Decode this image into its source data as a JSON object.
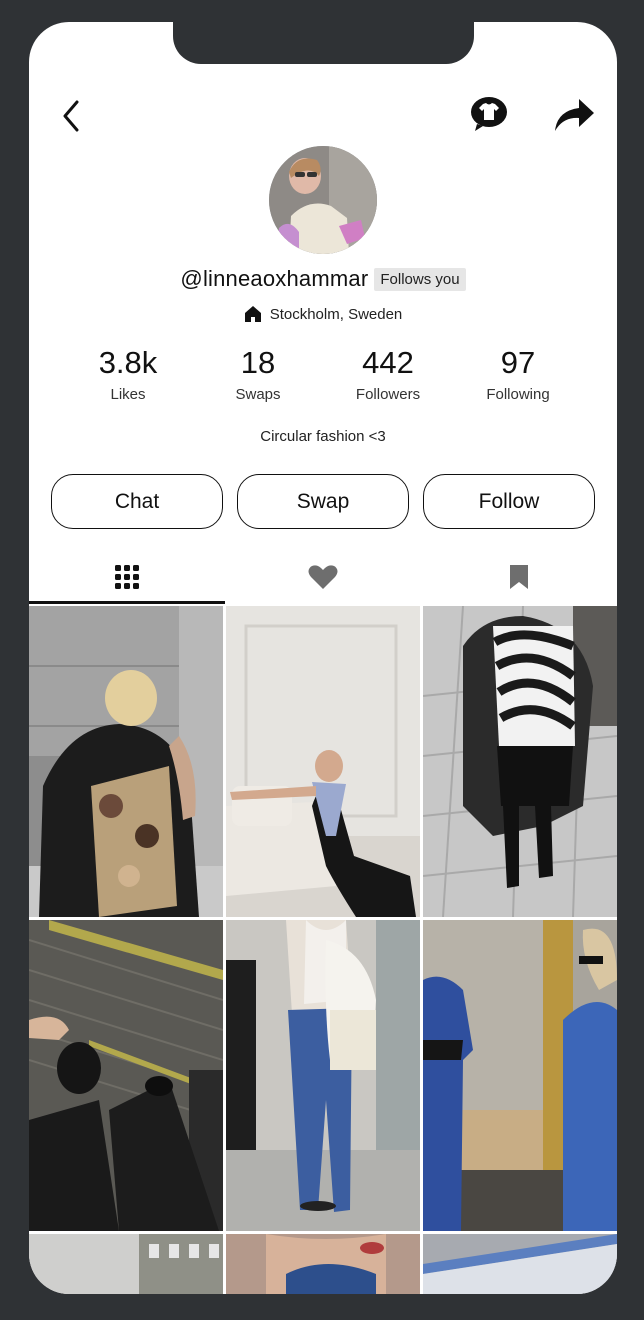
{
  "profile": {
    "username": "@linneaoxhammar",
    "follows_badge": "Follows you",
    "location": "Stockholm, Sweden",
    "bio": "Circular fashion <3"
  },
  "stats": [
    {
      "value": "3.8k",
      "label": "Likes"
    },
    {
      "value": "18",
      "label": "Swaps"
    },
    {
      "value": "442",
      "label": "Followers"
    },
    {
      "value": "97",
      "label": "Following"
    }
  ],
  "actions": {
    "chat": "Chat",
    "swap": "Swap",
    "follow": "Follow"
  },
  "tabs": [
    {
      "icon": "grid-icon",
      "active": true
    },
    {
      "icon": "heart-icon",
      "active": false
    },
    {
      "icon": "bookmark-icon",
      "active": false
    }
  ],
  "header_icons": {
    "back": "back-chevron-icon",
    "chat": "tshirt-chat-icon",
    "share": "share-arrow-icon"
  },
  "colors": {
    "background": "#2f3235",
    "screen": "#ffffff",
    "text": "#111111",
    "badge_bg": "#e6e6e6"
  }
}
